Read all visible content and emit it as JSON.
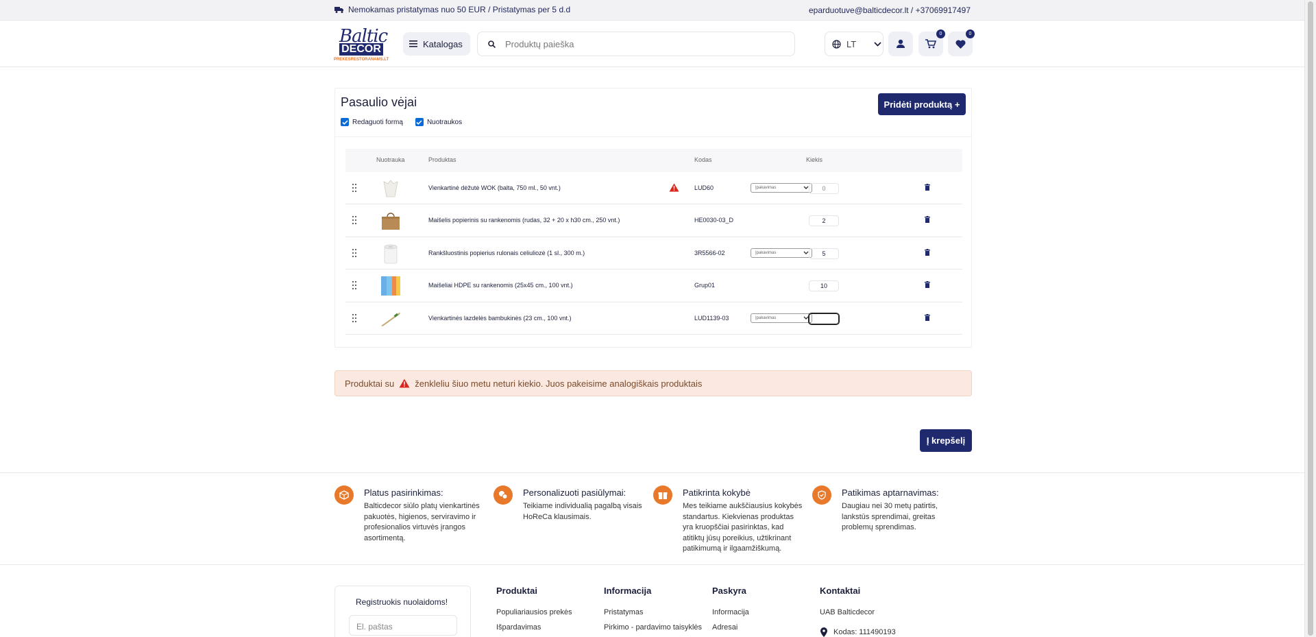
{
  "topbar": {
    "shipping_text": "Nemokamas pristatymas nuo 50 EUR / Pristatymas per 5 d.d",
    "contact_text": "eparduotuve@balticdecor.lt / +37069917497"
  },
  "header": {
    "logo_line1": "Baltic",
    "logo_line2": "DECOR",
    "logo_line3": "PREKESRESTORANAMS.LT",
    "catalog_label": "Katalogas",
    "search_placeholder": "Produktų paieška",
    "language": "LT",
    "cart_count": "0",
    "wishlist_count": "0"
  },
  "list": {
    "title": "Pasaulio vėjai",
    "add_button": "Pridėti produktą +",
    "check_edit_label": "Redaguoti formą",
    "check_photos_label": "Nuotraukos",
    "columns": {
      "photo": "Nuotrauka",
      "product": "Produktas",
      "code": "Kodas",
      "quantity": "Kiekis"
    },
    "select_placeholder": "Įpakavimas",
    "rows": [
      {
        "name": "Vienkartinė dėžutė WOK (balta, 750 ml., 50 vnt.)",
        "code": "LUD60",
        "qty": "0",
        "warning": true,
        "has_select": true
      },
      {
        "name": "Maišelis popierinis su rankenomis (rudas, 32 + 20 x h30 cm., 250 vnt.)",
        "code": "HE0030-03_D",
        "qty": "2",
        "warning": false,
        "has_select": false
      },
      {
        "name": "Rankšluostinis popierius rulonais celiuliozė (1 sl., 300 m.)",
        "code": "3R5566-02",
        "qty": "5",
        "warning": false,
        "has_select": true
      },
      {
        "name": "Maišeliai HDPE su rankenomis (25x45 cm., 100 vnt.)",
        "code": "Grup01",
        "qty": "10",
        "warning": false,
        "has_select": false
      },
      {
        "name": "Vienkartinės lazdelės bambukinės (23 cm., 100 vnt.)",
        "code": "LUD1139-03",
        "qty": "",
        "warning": false,
        "has_select": true
      }
    ]
  },
  "notice": {
    "before": "Produktai su",
    "after": "ženkleliu šiuo metu neturi kiekio. Juos pakeisime analogiškais produktais"
  },
  "cart_button": "Į krepšelį",
  "features": [
    {
      "title": "Platus pasirinkimas:",
      "text": "Balticdecor siūlo platų vienkartinės pakuotės, higienos, serviravimo ir profesionalios virtuvės įrangos asortimentą."
    },
    {
      "title": "Personalizuoti pasiūlymai:",
      "text": "Teikiame individualią pagalbą visais HoReCa klausimais."
    },
    {
      "title": "Patikrinta kokybė",
      "text": "Mes teikiame aukščiausius kokybės standartus. Kiekvienas produktas yra kruopščiai pasirinktas, kad atitiktų jūsų poreikius, užtikrinant patikimumą ir ilgaamžiškumą."
    },
    {
      "title": "Patikimas aptarnavimas:",
      "text": "Daugiau nei 30 metų patirtis, lankstūs sprendimai, greitas problemų sprendimas."
    }
  ],
  "footer": {
    "newsletter_title": "Registruokis nuolaidoms!",
    "newsletter_placeholder": "El. paštas",
    "products": {
      "heading": "Produktai",
      "items": [
        "Populiariausios prekės",
        "Išpardavimas"
      ]
    },
    "info": {
      "heading": "Informacija",
      "items": [
        "Pristatymas",
        "Pirkimo - pardavimo taisyklės"
      ]
    },
    "account": {
      "heading": "Paskyra",
      "items": [
        "Informacija",
        "Adresai"
      ]
    },
    "contacts": {
      "heading": "Kontaktai",
      "company": "UAB Balticdecor",
      "code": "Kodas: 111490193"
    }
  },
  "colors": {
    "primary": "#1f2a6e",
    "accent": "#e8792b",
    "warning": "#d9261c",
    "notice_bg": "#fbe9e1"
  }
}
